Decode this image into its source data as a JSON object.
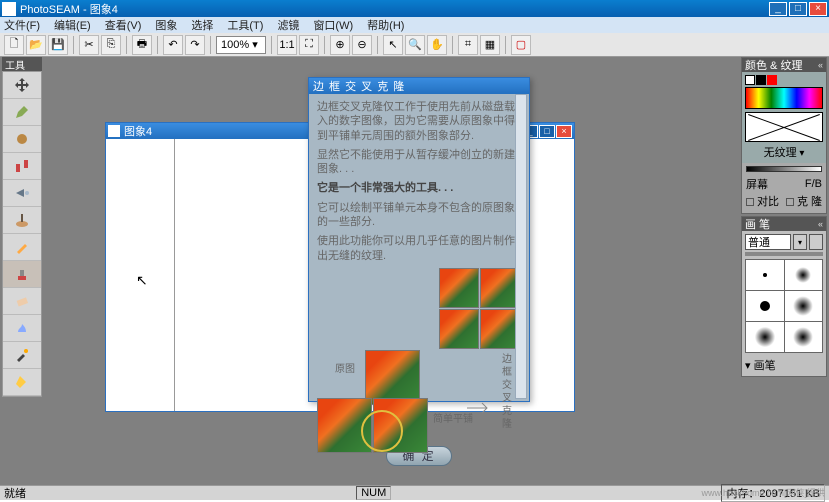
{
  "title": "PhotoSEAM - 图象4",
  "menu": [
    "文件(F)",
    "编辑(E)",
    "查看(V)",
    "图象",
    "选择",
    "工具(T)",
    "滤镜",
    "窗口(W)",
    "帮助(H)"
  ],
  "toolbar": {
    "zoom": "100%"
  },
  "left_panel": {
    "title": "工具"
  },
  "child_window": {
    "title": "图象4"
  },
  "dialog": {
    "title": "边 框 交 叉 克 隆",
    "p1": "边框交叉克隆仅工作于使用先前从磁盘载入的数字图像，因为它需要从原图象中得到平铺单元周围的额外图象部分.",
    "p2": "显然它不能使用于从暂存缓冲创立的新建图象. . .",
    "p3": "它是一个非常强大的工具. . .",
    "p4": "它可以绘制平铺单元本身不包含的原图象的一些部分.",
    "p5": "使用此功能你可以用几乎任意的图片制作出无缝的纹理.",
    "lbl_original": "原图",
    "lbl_cross": "边框\n交叉\n克隆",
    "lbl_simple": "简单平铺",
    "ok": "确 定"
  },
  "right": {
    "color_panel": "颜色 & 纹理",
    "no_texture": "无纹理",
    "screen": "屏幕",
    "fb": "F/B",
    "contrast": "对比",
    "clone": "克 隆",
    "brush_panel": "画 笔",
    "brush_mode": "普通",
    "brush_section": "画笔"
  },
  "status": {
    "ready": "就绪",
    "num": "NUM",
    "mem": "内存：2097151 KB"
  },
  "watermark": "www.hackhome.com[网侠]提供"
}
